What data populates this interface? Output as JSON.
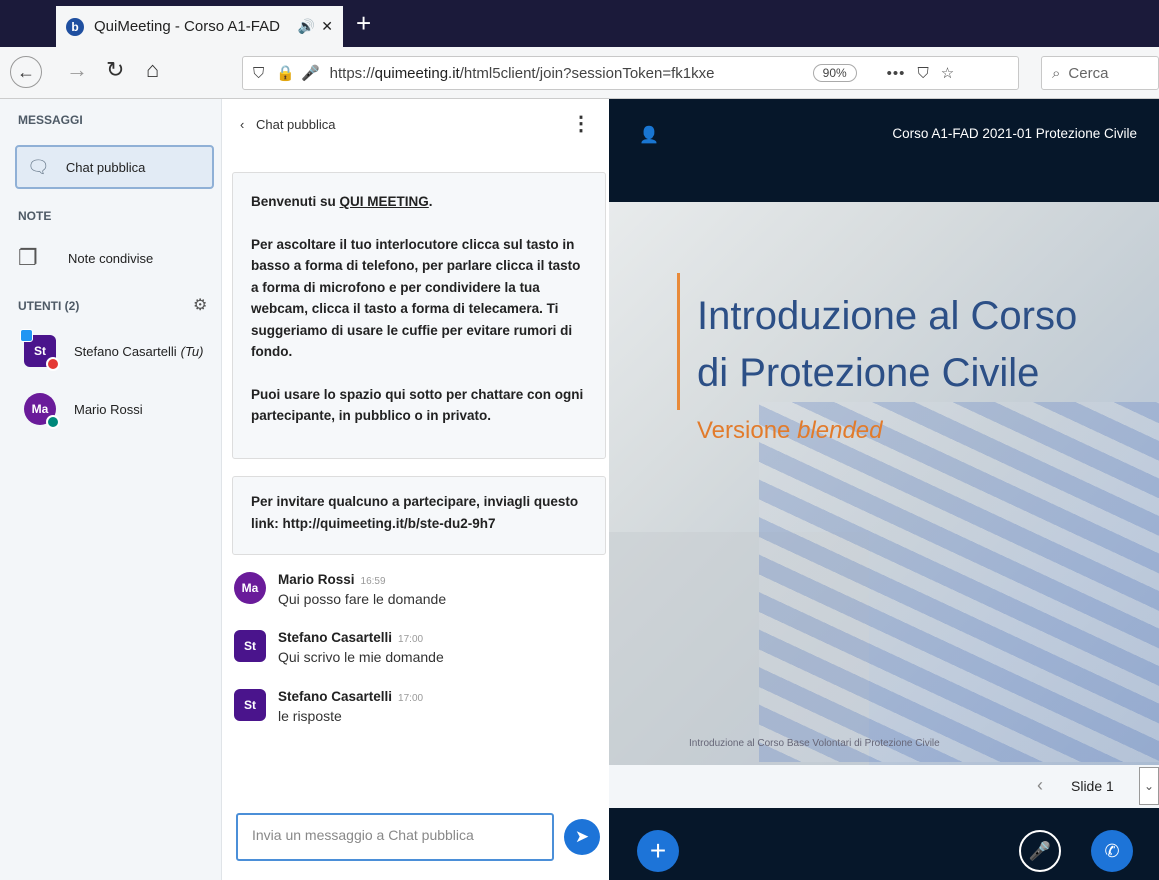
{
  "browser": {
    "tab_title": "QuiMeeting - Corso A1-FAD",
    "url_prefix": "https://",
    "url_host": "quimeeting.it",
    "url_path": "/html5client/join?sessionToken=fk1kxe",
    "zoom": "90%",
    "search_placeholder": "Cerca"
  },
  "sidebar": {
    "messages_header": "MESSAGGI",
    "public_chat_label": "Chat pubblica",
    "notes_header": "NOTE",
    "shared_notes_label": "Note condivise",
    "users_header": "UTENTI (2)",
    "users": [
      {
        "initials": "St",
        "name": "Stefano Casartelli",
        "suffix": "(Tu)"
      },
      {
        "initials": "Ma",
        "name": "Mario Rossi"
      }
    ]
  },
  "chat": {
    "header": "Chat pubblica",
    "welcome_intro": "Benvenuti su ",
    "welcome_brand": "QUI MEETING",
    "welcome_p1": "Per ascoltare il tuo interlocutore clicca sul tasto in basso a forma di telefono, per parlare clicca il tasto a forma di microfono e per condividere la tua webcam, clicca il tasto a forma di telecamera. Ti suggeriamo di usare le cuffie per evitare rumori di fondo.",
    "welcome_p2": "Puoi usare lo spazio qui sotto per chattare con ogni partecipante, in pubblico o in privato.",
    "invite_text": "Per invitare qualcuno a partecipare, inviagli questo link: http://quimeeting.it/b/ste-du2-9h7",
    "messages": [
      {
        "initials": "Ma",
        "name": "Mario Rossi",
        "time": "16:59",
        "text": "Qui posso fare le domande"
      },
      {
        "initials": "St",
        "name": "Stefano Casartelli",
        "time": "17:00",
        "text": "Qui scrivo le mie domande"
      },
      {
        "initials": "St",
        "name": "Stefano Casartelli",
        "time": "17:00",
        "text": "le risposte"
      }
    ],
    "input_placeholder": "Invia un messaggio a Chat pubblica"
  },
  "presentation": {
    "meeting_title": "Corso A1-FAD 2021-01 Protezione Civile",
    "slide_title_line1": "Introduzione al Corso",
    "slide_title_line2": "di Protezione Civile",
    "slide_subtitle": "Versione ",
    "slide_subtitle_italic": "blended",
    "slide_footer": "Introduzione al Corso Base Volontari di Protezione Civile",
    "slide_selector": "Slide 1"
  },
  "colors": {
    "accent_blue": "#1d74d8",
    "avatar_purple": "#4a148c",
    "slide_title": "#2c4f86",
    "slide_subtitle": "#e27b2b",
    "pres_bg": "#06172a"
  }
}
